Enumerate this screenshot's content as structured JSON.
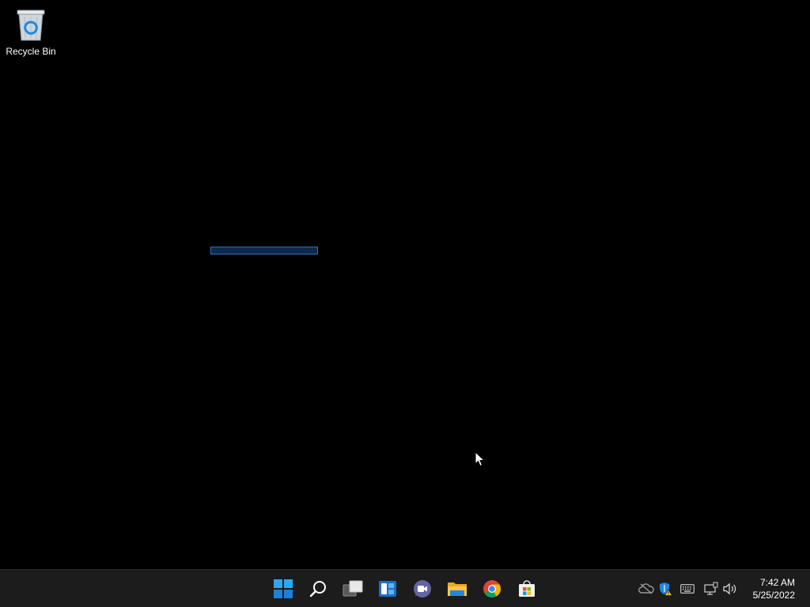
{
  "desktop": {
    "icons": [
      {
        "label": "Recycle Bin",
        "icon": "recycle-bin-icon"
      }
    ]
  },
  "taskbar": {
    "pinned": [
      {
        "name": "Start",
        "icon": "windows-start-icon"
      },
      {
        "name": "Search",
        "icon": "search-icon"
      },
      {
        "name": "Task View",
        "icon": "task-view-icon"
      },
      {
        "name": "Widgets",
        "icon": "widgets-icon"
      },
      {
        "name": "Chat",
        "icon": "teams-chat-icon"
      },
      {
        "name": "File Explorer",
        "icon": "file-explorer-icon"
      },
      {
        "name": "Google Chrome",
        "icon": "chrome-icon"
      },
      {
        "name": "Microsoft Store",
        "icon": "store-icon"
      }
    ],
    "tray": [
      {
        "name": "OneDrive",
        "icon": "onedrive-icon"
      },
      {
        "name": "Windows Security",
        "icon": "security-shield-warning-icon"
      },
      {
        "name": "Touch keyboard",
        "icon": "keyboard-icon"
      },
      {
        "name": "Network",
        "icon": "network-icon"
      },
      {
        "name": "Volume",
        "icon": "volume-icon"
      }
    ],
    "clock": {
      "time": "7:42 AM",
      "date": "5/25/2022"
    }
  },
  "colors": {
    "desktop_bg": "#000000",
    "taskbar_bg": "#1c1c1c",
    "accent": "#0078d4",
    "selection_border": "#2f6fb5"
  }
}
